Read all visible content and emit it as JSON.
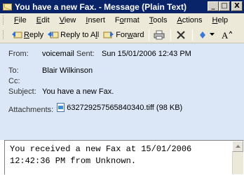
{
  "window": {
    "title": "You have a new Fax. - Message (Plain Text)",
    "minimize": "_",
    "maximize": "□",
    "close": "X"
  },
  "menu": {
    "items": [
      {
        "label": "File",
        "u": "F",
        "rest": "ile"
      },
      {
        "label": "Edit",
        "u": "E",
        "rest": "dit"
      },
      {
        "label": "View",
        "u": "V",
        "rest": "iew"
      },
      {
        "label": "Insert",
        "u": "I",
        "rest": "nsert"
      },
      {
        "label": "Format",
        "pre": "F",
        "u": "o",
        "rest": "rmat"
      },
      {
        "label": "Tools",
        "u": "T",
        "rest": "ools"
      },
      {
        "label": "Actions",
        "u": "A",
        "rest": "ctions"
      },
      {
        "label": "Help",
        "u": "H",
        "rest": "elp"
      }
    ]
  },
  "toolbar": {
    "reply": "Reply",
    "reply_all": "Reply to All",
    "forward": "Forward",
    "print_icon": "printer-icon",
    "delete_icon": "delete-icon",
    "move_icon": "move-icon",
    "font_icon": "font-size-icon",
    "reply_u": "R",
    "reply_rest": "eply",
    "reply_all_pre": "Reply to A",
    "reply_all_u": "l",
    "reply_all_rest": "l",
    "forward_pre": "For",
    "forward_u": "w",
    "forward_rest": "ard"
  },
  "header": {
    "from_label": "From:",
    "from_value": "voicemail",
    "sent_label": "Sent:",
    "sent_value": "Sun 15/01/2006 12:43 PM",
    "to_label": "To:",
    "to_value": "Blair Wilkinson",
    "cc_label": "Cc:",
    "cc_value": "",
    "subject_label": "Subject:",
    "subject_value": "You have a new Fax.",
    "attachments_label": "Attachments:",
    "attachment_file": "632729257565840340.tiff (98 KB)"
  },
  "body": {
    "line1": "You received a new Fax at 15/01/2006",
    "line2": "12:42:36 PM from Unknown."
  }
}
